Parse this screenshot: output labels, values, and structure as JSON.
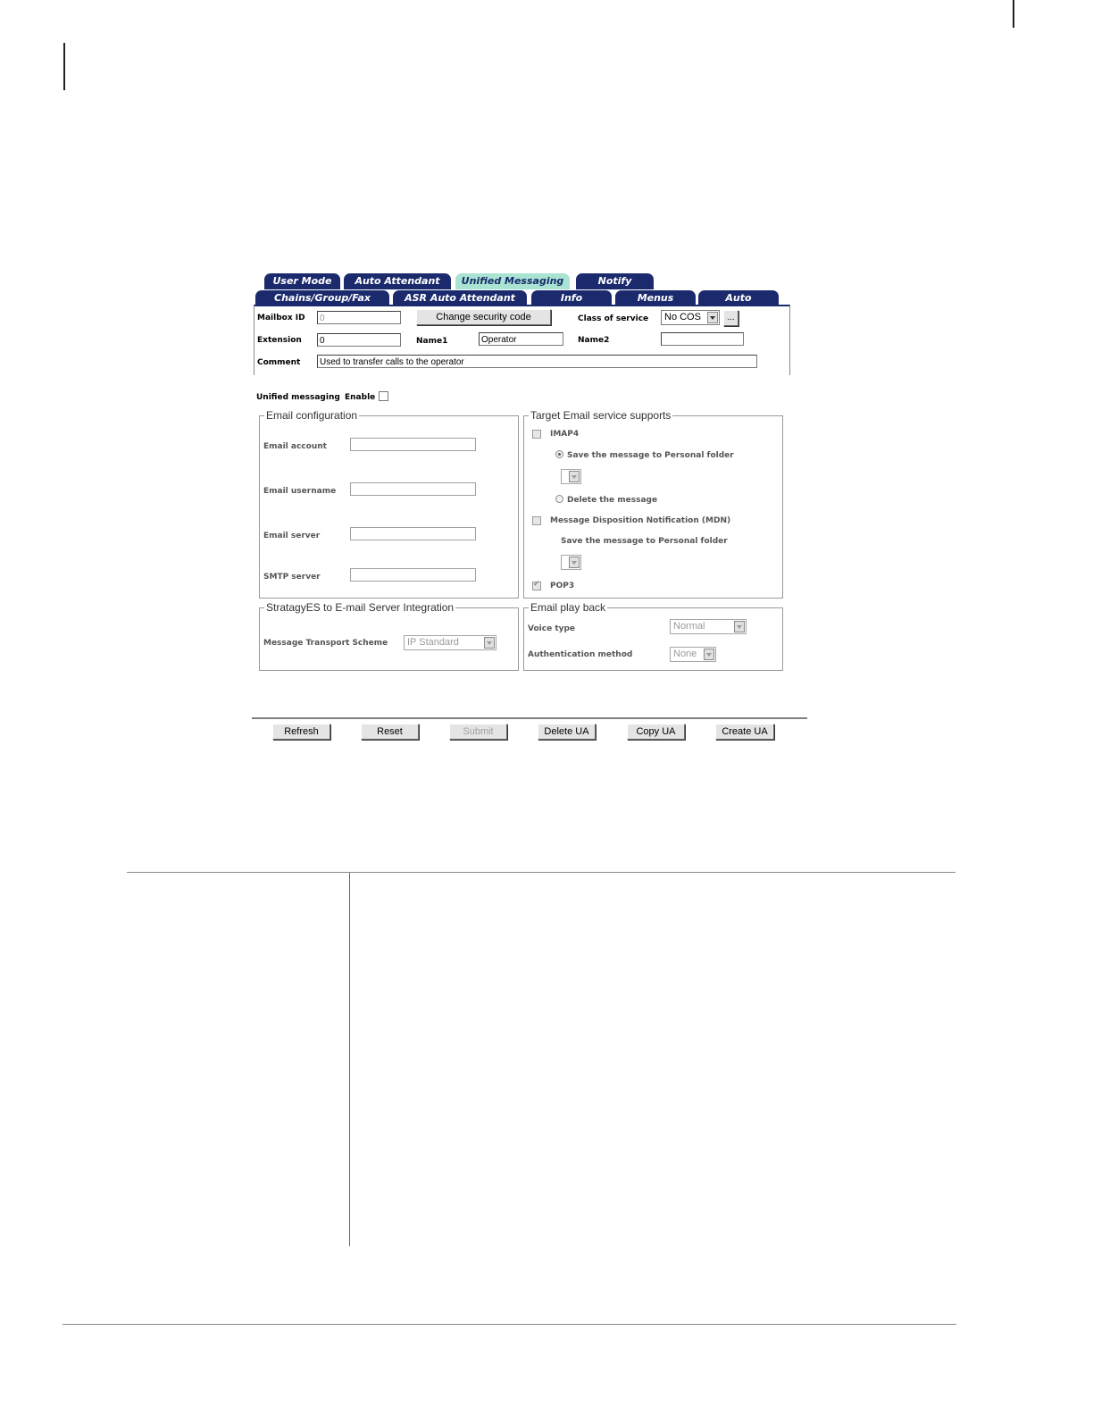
{
  "tabs": {
    "row1": [
      "User Mode",
      "Auto Attendant",
      "Unified Messaging",
      "Notify"
    ],
    "row2": [
      "Chains/Group/Fax",
      "ASR Auto Attendant",
      "Info",
      "Menus",
      "Auto"
    ],
    "active": "Unified Messaging"
  },
  "mailbox": {
    "mailbox_id_label": "Mailbox ID",
    "mailbox_id_value": "0",
    "change_security_label": "Change security code",
    "cos_label": "Class of service",
    "cos_value": "No COS",
    "cos_more_label": "...",
    "extension_label": "Extension",
    "extension_value": "0",
    "name1_label": "Name1",
    "name1_value": "Operator",
    "name2_label": "Name2",
    "name2_value": "",
    "comment_label": "Comment",
    "comment_value": "Used to transfer calls to the operator"
  },
  "unified": {
    "label": "Unified messaging",
    "enable_label": "Enable",
    "enabled": false
  },
  "email_config": {
    "legend": "Email configuration",
    "account_label": "Email account",
    "username_label": "Email username",
    "server_label": "Email server",
    "smtp_label": "SMTP server"
  },
  "target": {
    "legend": "Target Email service supports",
    "imap4_label": "IMAP4",
    "save_personal_label": "Save the message to Personal folder",
    "delete_label": "Delete the message",
    "mdn_label": "Message Disposition Notification (MDN)",
    "mdn_save_label": "Save the message to Personal folder",
    "pop3_label": "POP3",
    "pop3_checked": true
  },
  "integration": {
    "legend": "StratagyES to E-mail Server Integration",
    "scheme_label": "Message Transport Scheme",
    "scheme_value": "IP Standard"
  },
  "playback": {
    "legend": "Email play back",
    "voice_label": "Voice type",
    "voice_value": "Normal",
    "auth_label": "Authentication method",
    "auth_value": "None"
  },
  "actions": {
    "refresh": "Refresh",
    "reset": "Reset",
    "submit": "Submit",
    "delete_ua": "Delete UA",
    "copy_ua": "Copy UA",
    "create_ua": "Create UA"
  },
  "colors": {
    "tab_bg": "#1a2a6c",
    "tab_active_bg": "#a9e3d2"
  }
}
